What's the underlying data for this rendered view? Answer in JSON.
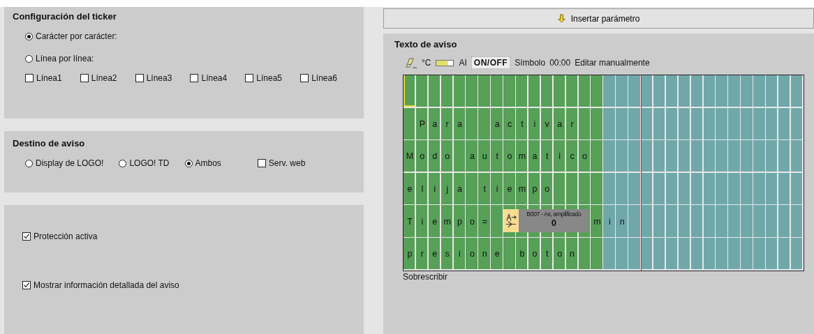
{
  "ticker": {
    "title": "Configuración del ticker",
    "modes": [
      {
        "label": "Carácter por carácter:",
        "selected": true
      },
      {
        "label": "Línea por línea:",
        "selected": false
      }
    ],
    "lines": [
      {
        "label": "Línea1",
        "checked": false
      },
      {
        "label": "Línea2",
        "checked": false
      },
      {
        "label": "Línea3",
        "checked": false
      },
      {
        "label": "Línea4",
        "checked": false
      },
      {
        "label": "Línea5",
        "checked": false
      },
      {
        "label": "Línea6",
        "checked": false
      }
    ]
  },
  "destination": {
    "title": "Destino de aviso",
    "targets": [
      {
        "label": "Display de LOGO!",
        "selected": false
      },
      {
        "label": "LOGO! TD",
        "selected": false
      },
      {
        "label": "Ambos",
        "selected": true
      }
    ],
    "web": {
      "label": "Serv. web",
      "checked": false
    }
  },
  "options": [
    {
      "label": "Protección activa",
      "checked": true
    },
    {
      "label": "Mostrar información detallada del aviso",
      "checked": true
    }
  ],
  "insert_button": {
    "label": "Insertar parámetro"
  },
  "message": {
    "title": "Texto de aviso",
    "toolbar": [
      {
        "kind": "eraser"
      },
      {
        "kind": "text",
        "label": "°C"
      },
      {
        "kind": "bar"
      },
      {
        "kind": "text",
        "label": "AI"
      },
      {
        "kind": "boxed",
        "label": "ON/OFF"
      },
      {
        "kind": "text",
        "label": "Símbolo"
      },
      {
        "kind": "text",
        "label": "00:00"
      },
      {
        "kind": "text",
        "label": "Editar manualmente"
      }
    ],
    "rows": [
      {
        "kind": "cursor"
      },
      {
        "kind": "text",
        "cells": [
          null,
          "P",
          "a",
          "r",
          "a",
          null,
          null,
          "a",
          "c",
          "t",
          "i",
          "v",
          "a",
          "r"
        ]
      },
      {
        "kind": "text",
        "cells": [
          "M",
          "o",
          "d",
          "o",
          null,
          "a",
          "u",
          "t",
          "o",
          "m",
          "a",
          "t",
          "i",
          "c",
          "o"
        ]
      },
      {
        "kind": "text",
        "cells": [
          "e",
          "l",
          "i",
          "j",
          "a",
          null,
          "t",
          "i",
          "e",
          "m",
          "p",
          "o"
        ]
      },
      {
        "kind": "parameter",
        "before": [
          "T",
          "i",
          "e",
          "m",
          "p",
          "o",
          "="
        ],
        "block": "B007 - Ax, amplificado",
        "value": "0",
        "after": [
          "m",
          "i",
          "n"
        ]
      },
      {
        "kind": "text",
        "cells": [
          "p",
          "r",
          "e",
          "s",
          "i",
          "o",
          "n",
          "e",
          null,
          "b",
          "o",
          "t",
          "o",
          "n"
        ]
      }
    ],
    "mode": "Sobrescribir"
  }
}
